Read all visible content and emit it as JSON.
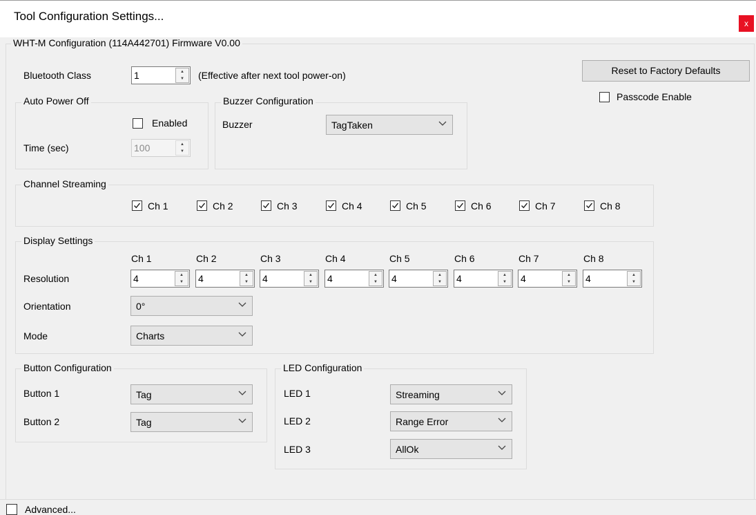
{
  "window": {
    "title": "Tool Configuration Settings...",
    "close_glyph": "x"
  },
  "main_group": {
    "label": "WHT-M Configuration (114A442701) Firmware V0.00"
  },
  "bluetooth": {
    "label": "Bluetooth Class",
    "value": "1",
    "note": "(Effective after next tool power-on)"
  },
  "reset_button": {
    "label": "Reset to Factory Defaults"
  },
  "passcode": {
    "label": "Passcode Enable",
    "checked": false
  },
  "auto_power_off": {
    "label": "Auto Power Off",
    "enabled_label": "Enabled",
    "enabled": false,
    "time_label": "Time (sec)",
    "time_value": "100"
  },
  "buzzer": {
    "label": "Buzzer Configuration",
    "field_label": "Buzzer",
    "value": "TagTaken"
  },
  "channel_streaming": {
    "label": "Channel Streaming",
    "channels": [
      {
        "label": "Ch 1",
        "checked": true
      },
      {
        "label": "Ch 2",
        "checked": true
      },
      {
        "label": "Ch 3",
        "checked": true
      },
      {
        "label": "Ch 4",
        "checked": true
      },
      {
        "label": "Ch 5",
        "checked": true
      },
      {
        "label": "Ch 6",
        "checked": true
      },
      {
        "label": "Ch 7",
        "checked": true
      },
      {
        "label": "Ch 8",
        "checked": true
      }
    ]
  },
  "display": {
    "label": "Display Settings",
    "channels": [
      "Ch 1",
      "Ch 2",
      "Ch 3",
      "Ch 4",
      "Ch 5",
      "Ch 6",
      "Ch 7",
      "Ch 8"
    ],
    "resolution_label": "Resolution",
    "resolutions": [
      "4",
      "4",
      "4",
      "4",
      "4",
      "4",
      "4",
      "4"
    ],
    "orientation_label": "Orientation",
    "orientation_value": "0°",
    "mode_label": "Mode",
    "mode_value": "Charts"
  },
  "button_config": {
    "label": "Button Configuration",
    "button1_label": "Button 1",
    "button1_value": "Tag",
    "button2_label": "Button 2",
    "button2_value": "Tag"
  },
  "led_config": {
    "label": "LED Configuration",
    "led1_label": "LED 1",
    "led1_value": "Streaming",
    "led2_label": "LED 2",
    "led2_value": "Range Error",
    "led3_label": "LED 3",
    "led3_value": "AllOk"
  },
  "advanced": {
    "label": "Advanced...",
    "checked": false
  }
}
